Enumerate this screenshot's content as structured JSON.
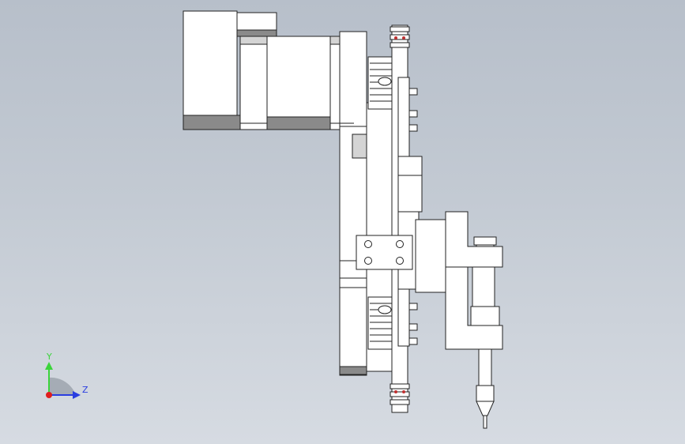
{
  "viewport": {
    "background_top": "#b7bfca",
    "background_bottom": "#d6dbe2"
  },
  "triad": {
    "y_label": "Y",
    "z_label": "Z",
    "y_color": "#3bd43b",
    "z_color": "#2a3ee0",
    "x_color": "#e01e1e"
  }
}
